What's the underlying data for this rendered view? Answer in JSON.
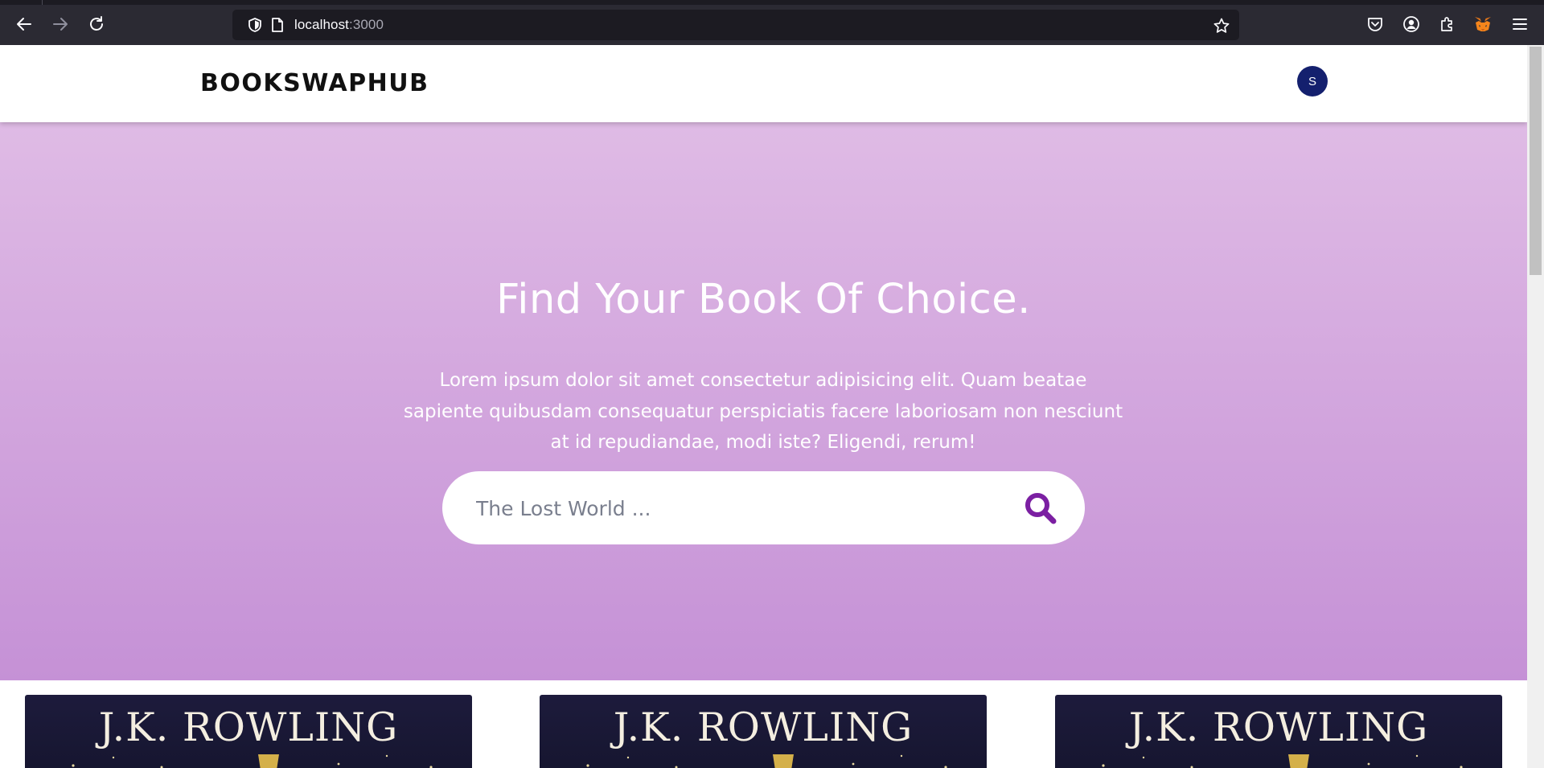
{
  "browser": {
    "url_host": "localhost",
    "url_port": ":3000",
    "icons": {
      "back": "arrow-left-icon",
      "forward": "arrow-right-icon",
      "reload": "reload-icon",
      "tracking": "shield-icon",
      "page": "page-icon",
      "bookmark": "star-icon",
      "pocket": "pocket-icon",
      "account": "account-icon",
      "extensions": "puzzle-icon",
      "metamask": "fox-icon",
      "menu": "hamburger-icon"
    }
  },
  "navbar": {
    "logo": "BOOKSWAPHUB",
    "avatar_initial": "S",
    "avatar_color": "#14206e"
  },
  "hero": {
    "title": "Find Your Book Of Choice.",
    "description": "Lorem ipsum dolor sit amet consectetur adipisicing elit. Quam beatae sapiente quibusdam consequatur perspiciatis facere laboriosam non nesciunt at id repudiandae, modi iste? Eligendi, rerum!",
    "gradient_top": "#dfbbe5",
    "gradient_bottom": "#c591d6"
  },
  "search": {
    "placeholder": "The Lost World ...",
    "icon": "search-icon",
    "icon_color": "#7b1fa2"
  },
  "books": [
    {
      "author": "J.K. ROWLING"
    },
    {
      "author": "J.K. ROWLING"
    },
    {
      "author": "J.K. ROWLING"
    }
  ]
}
